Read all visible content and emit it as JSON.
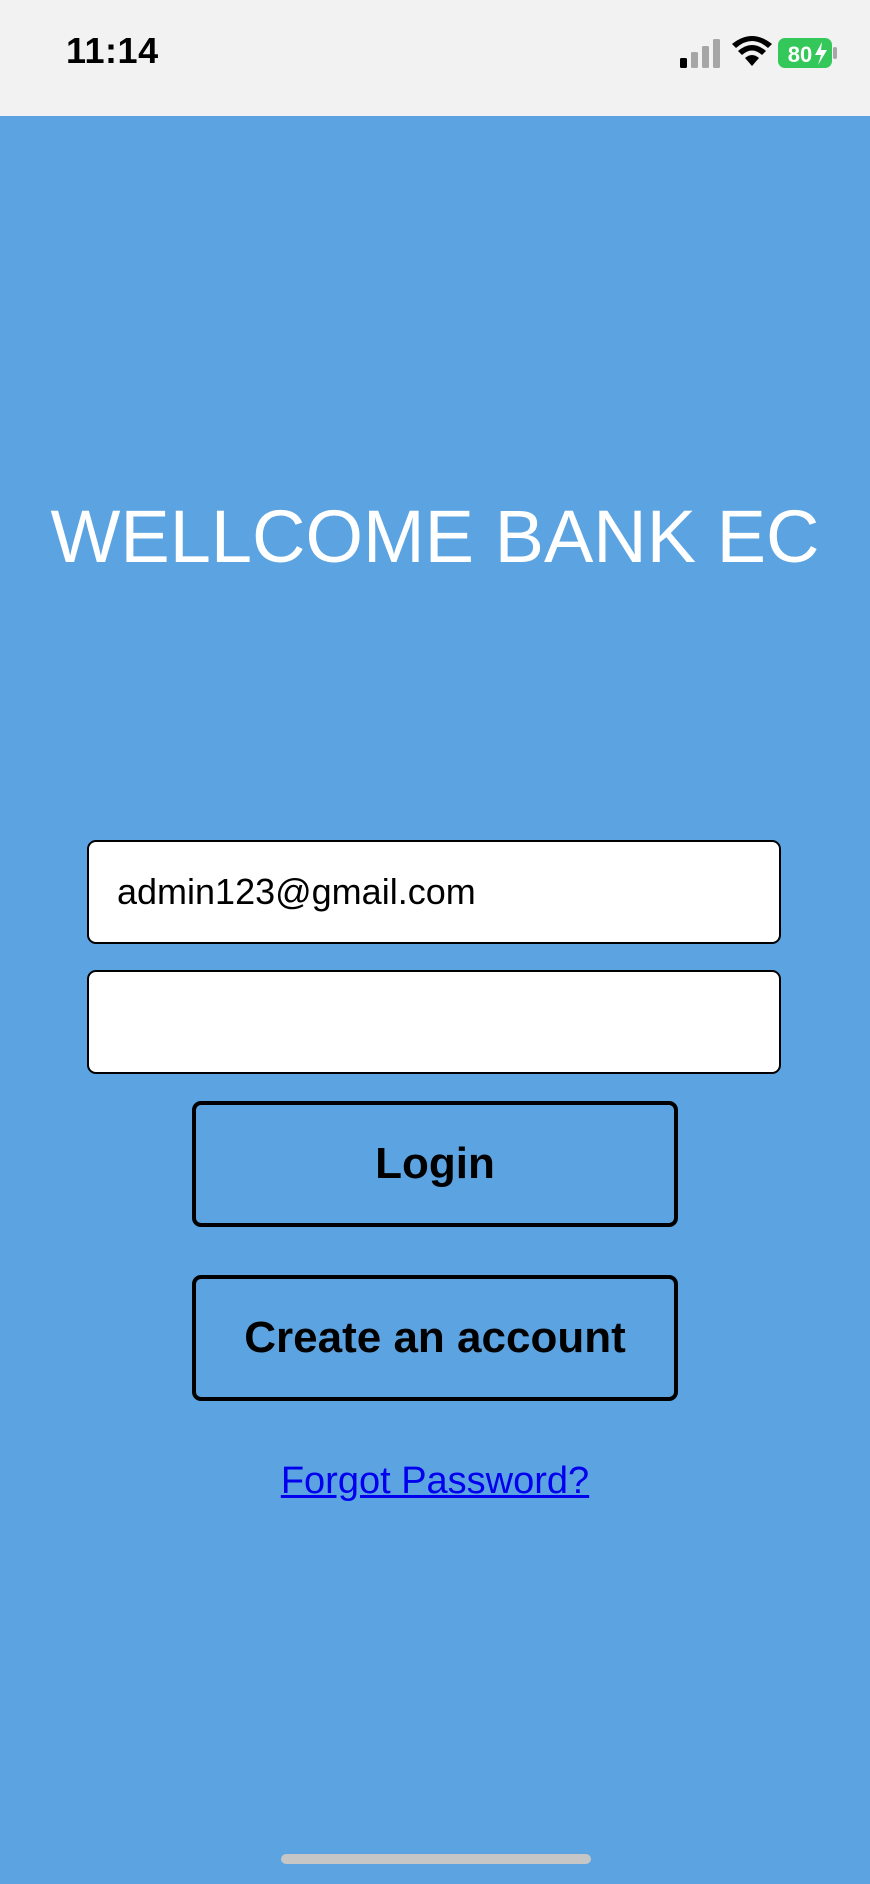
{
  "status_bar": {
    "time": "11:14",
    "battery_level": "80",
    "signal_bars_active": 1,
    "signal_bars_total": 4,
    "colors": {
      "battery": "#34c759",
      "background": "#f2f2f2"
    }
  },
  "screen": {
    "background_color": "#5ca4e1",
    "title": "WELLCOME BANK EC"
  },
  "login_form": {
    "email_value": "admin123@gmail.com",
    "password_value": "",
    "login_label": "Login",
    "create_account_label": "Create an account",
    "forgot_password_label": "Forgot Password?"
  },
  "icons": {
    "signal": "cellular-signal-icon",
    "wifi": "wifi-icon",
    "battery": "battery-charging-icon"
  }
}
